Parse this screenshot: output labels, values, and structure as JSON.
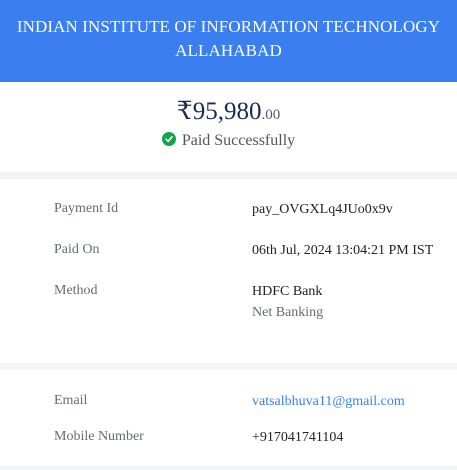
{
  "header": {
    "line1": "INDIAN INSTITUTE OF INFORMATION TECHNOLOGY",
    "line2": "ALLAHABAD",
    "color": "#3a7ef0"
  },
  "summary": {
    "amount_main": "₹95,980",
    "amount_decimal": ".00",
    "status_text": "Paid Successfully",
    "status_icon": "check-circle-icon",
    "status_color": "#18a34a"
  },
  "details": {
    "payment_id_label": "Payment Id",
    "payment_id_value": "pay_OVGXLq4JUo0x9v",
    "paid_on_label": "Paid On",
    "paid_on_value": "06th Jul, 2024 13:04:21 PM IST",
    "method_label": "Method",
    "method_value": "HDFC Bank",
    "method_sub": "Net Banking"
  },
  "contact": {
    "email_label": "Email",
    "email_value": "vatsalbhuva11@gmail.com",
    "mobile_label": "Mobile Number",
    "mobile_value": "+917041741104"
  }
}
